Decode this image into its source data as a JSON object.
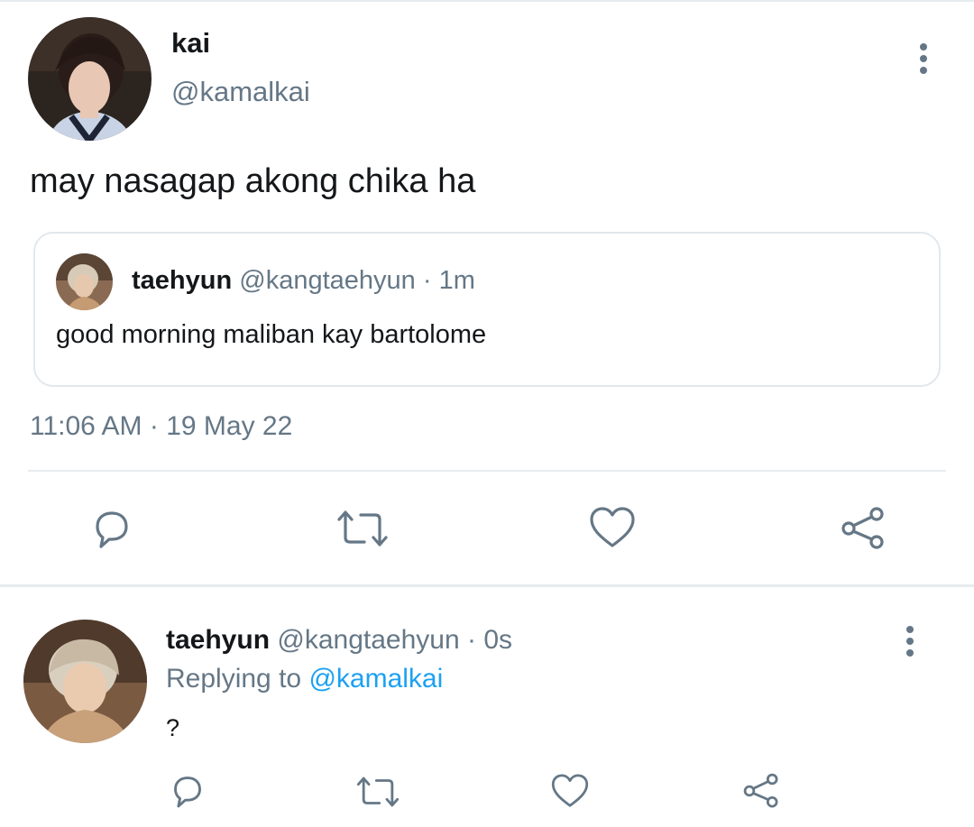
{
  "main_tweet": {
    "name": "kai",
    "handle": "@kamalkai",
    "text": "may nasagap akong chika ha",
    "quoted": {
      "name": "taehyun",
      "handle": "@kangtaehyun",
      "separator": "·",
      "age": "1m",
      "text": "good morning maliban kay bartolome"
    },
    "time": "11:06 AM",
    "separator": "·",
    "date": "19 May 22",
    "actions": [
      "reply-icon",
      "retweet-icon",
      "like-icon",
      "share-icon"
    ]
  },
  "reply": {
    "name": "taehyun",
    "handle": "@kangtaehyun",
    "separator": "·",
    "age": "0s",
    "replying_prefix": "Replying to",
    "replying_to": "@kamalkai",
    "text": "?",
    "actions": [
      "reply-icon",
      "retweet-icon",
      "like-icon",
      "share-icon"
    ]
  },
  "colors": {
    "text": "#14171a",
    "secondary": "#657786",
    "link": "#1da1f2",
    "border": "#e1e8ed",
    "background": "#ffffff"
  }
}
